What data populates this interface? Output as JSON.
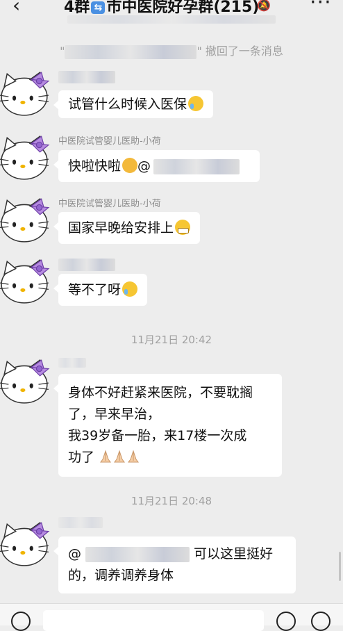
{
  "header": {
    "back_icon": "back-chevron-icon",
    "title_prefix": "4群",
    "title_main": "市中医院好孕群(215)",
    "mute_icon": "bell-muted-icon",
    "more_icon": "ellipsis-icon"
  },
  "system": {
    "recall_suffix": "\" 撤回了一条消息",
    "recall_prefix": "\""
  },
  "messages": [
    {
      "nick": "",
      "text": "试管什么时候入医保",
      "emoji": "crying-emoji"
    },
    {
      "nick": "中医院试管婴儿医助-小荷",
      "text": "快啦快啦",
      "mention": "@",
      "emoji": "thinking-emoji"
    },
    {
      "nick": "中医院试管婴儿医助-小荷",
      "text": "国家早晚给安排上",
      "emoji": "grinning-emoji"
    },
    {
      "nick": "",
      "text": "等不了呀",
      "emoji": "crying-emoji"
    },
    {
      "nick": "",
      "lines": [
        "身体不好赶紧来医院，不要耽搁",
        "了，早来早治，",
        "我39岁备一胎，来17楼一次成",
        "功了"
      ],
      "emoji": "praying-hands-emoji"
    },
    {
      "nick": "",
      "mention": "@",
      "lines": [
        "可以这里挺好",
        "的，调养调养身体"
      ]
    }
  ],
  "timestamps": [
    "11月21日 20:42",
    "11月21日 20:48"
  ],
  "input": {
    "voice_icon": "voice-icon",
    "emoji_icon": "emoji-icon",
    "add_icon": "plus-icon"
  }
}
